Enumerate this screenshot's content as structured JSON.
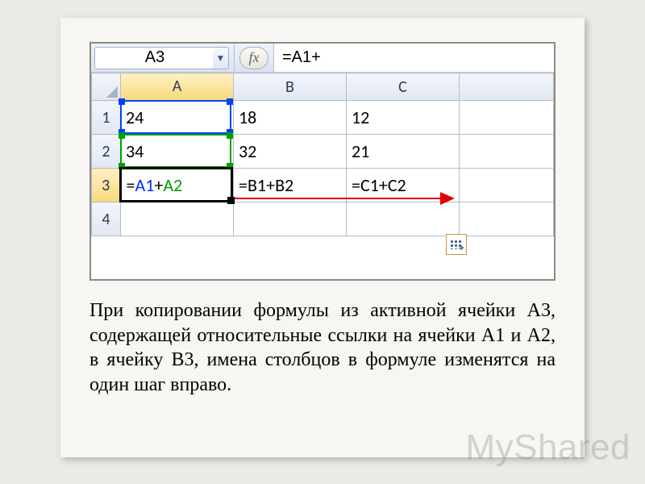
{
  "name_box": "A3",
  "fx_label": "fx",
  "formula_entry": "=A1+",
  "columns": [
    "A",
    "B",
    "C",
    ""
  ],
  "rows": [
    {
      "hdr": "1",
      "cells": [
        "24",
        "18",
        "12",
        ""
      ]
    },
    {
      "hdr": "2",
      "cells": [
        "34",
        "32",
        "21",
        ""
      ]
    },
    {
      "hdr": "3",
      "cells_formula": [
        {
          "parts": [
            {
              "t": "="
            },
            {
              "t": "A1",
              "cls": "ref-blue"
            },
            {
              "t": "+"
            },
            {
              "t": "A2",
              "cls": "ref-green"
            }
          ]
        },
        {
          "parts": [
            {
              "t": "="
            },
            {
              "t": "B1"
            },
            {
              "t": "+"
            },
            {
              "t": "B2"
            }
          ]
        },
        {
          "parts": [
            {
              "t": "="
            },
            {
              "t": "C1"
            },
            {
              "t": "+"
            },
            {
              "t": "C2"
            }
          ]
        },
        {
          "parts": []
        }
      ]
    },
    {
      "hdr": "4",
      "cells": [
        "",
        "",
        "",
        ""
      ]
    }
  ],
  "active_cell": "A3",
  "caption": "При копировании формулы из активной ячейки A3, содержащей относительные ссылки на ячейки A1 и A2, в ячейку B3, имена столбцов в формуле изменятся на один шаг вправо.",
  "watermark": "MyShared",
  "icons": {
    "dropdown": "▼",
    "autofill_plus": "+"
  }
}
